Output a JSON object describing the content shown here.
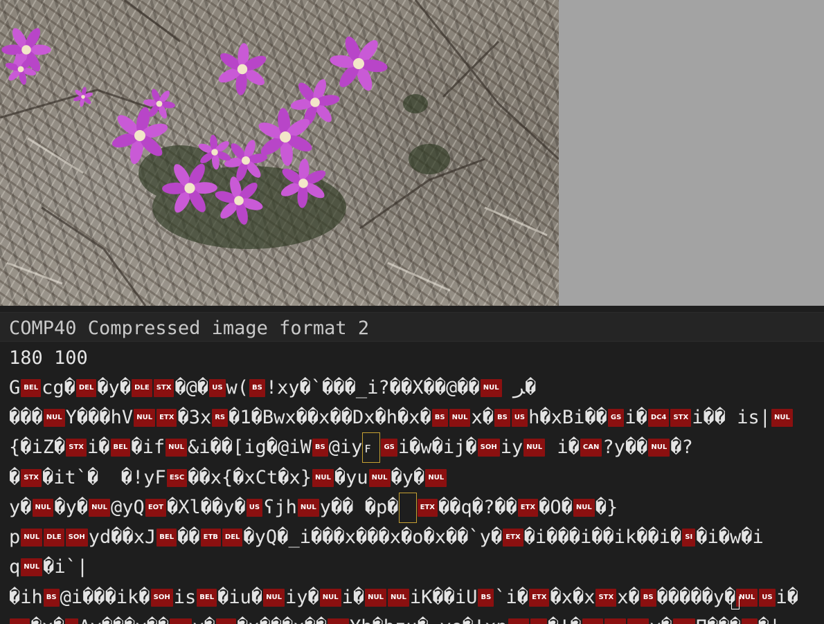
{
  "viewer": {
    "image_alt": "photo of pink star-shaped wildflowers on gravelly ground"
  },
  "editor": {
    "lines": [
      [
        {
          "t": "COMP40 Compressed image format 2"
        }
      ],
      [
        {
          "t": "180 100"
        }
      ],
      [
        {
          "t": "G"
        },
        {
          "c": "BEL"
        },
        {
          "t": "cg�"
        },
        {
          "c": "DEL"
        },
        {
          "t": "�y�"
        },
        {
          "c": "DLE"
        },
        {
          "c": "STX"
        },
        {
          "t": "�@�"
        },
        {
          "c": "US"
        },
        {
          "t": "w("
        },
        {
          "c": "BS"
        },
        {
          "t": "!xy�`���_i?��X��@��"
        },
        {
          "c": "NUL"
        },
        {
          "t": " ﺮ�"
        }
      ],
      [
        {
          "t": "���"
        },
        {
          "c": "NUL"
        },
        {
          "t": "Y���hV"
        },
        {
          "c": "NUL"
        },
        {
          "c": "ETX"
        },
        {
          "t": "�3x"
        },
        {
          "c": "RS"
        },
        {
          "t": "�1�Bwx��x��Dx�h�x�"
        },
        {
          "c": "BS"
        },
        {
          "c": "NUL"
        },
        {
          "t": "x�"
        },
        {
          "c": "BS"
        },
        {
          "c": "US"
        },
        {
          "t": "h�xBi��"
        },
        {
          "c": "GS"
        },
        {
          "t": "i�"
        },
        {
          "c": "DC4"
        },
        {
          "c": "STX"
        },
        {
          "t": "i�� is|"
        },
        {
          "c": "NUL"
        }
      ],
      [
        {
          "t": "{�iZ�"
        },
        {
          "c": "STX"
        },
        {
          "t": "i�"
        },
        {
          "c": "BEL"
        },
        {
          "t": "�if"
        },
        {
          "c": "NUL"
        },
        {
          "t": "&i��[ig�@iW"
        },
        {
          "c": "BS"
        },
        {
          "t": "@iy"
        },
        {
          "m": "FF"
        },
        {
          "c": "GS"
        },
        {
          "t": "i�w�ij�"
        },
        {
          "c": "SOH"
        },
        {
          "t": "iy"
        },
        {
          "c": "NUL"
        },
        {
          "t": " i�"
        },
        {
          "c": "CAN"
        },
        {
          "t": "?y��"
        },
        {
          "c": "NUL"
        },
        {
          "t": "�?"
        }
      ],
      [
        {
          "t": "�"
        },
        {
          "c": "STX"
        },
        {
          "t": "�it`�  �!yF"
        },
        {
          "c": "ESC"
        },
        {
          "t": "��x{�xCt�x}"
        },
        {
          "c": "NUL"
        },
        {
          "t": "�yu"
        },
        {
          "c": "NUL"
        },
        {
          "t": "�y�"
        },
        {
          "c": "NUL"
        }
      ],
      [
        {
          "t": "y�"
        },
        {
          "c": "NUL"
        },
        {
          "t": "�y�"
        },
        {
          "c": "NUL"
        },
        {
          "t": "@yQ"
        },
        {
          "c": "EOT"
        },
        {
          "t": "�Xl��y�"
        },
        {
          "c": "US"
        },
        {
          "t": "ʕjh"
        },
        {
          "c": "NUL"
        },
        {
          "t": "y�� �p�"
        },
        {
          "m": "`"
        },
        {
          "c": "ETX"
        },
        {
          "t": "��q�?��"
        },
        {
          "c": "ETX"
        },
        {
          "t": "�O�"
        },
        {
          "c": "NUL"
        },
        {
          "t": "�}"
        }
      ],
      [
        {
          "t": "p"
        },
        {
          "c": "NUL"
        },
        {
          "c": "DLE"
        },
        {
          "c": "SOH"
        },
        {
          "t": "yd��xJ"
        },
        {
          "c": "BEL"
        },
        {
          "t": "��"
        },
        {
          "c": "ETB"
        },
        {
          "c": "DEL"
        },
        {
          "t": "�yQ�_i���x���x�o�x��`y�"
        },
        {
          "c": "ETX"
        },
        {
          "t": "�i���i��ik��i�"
        },
        {
          "c": "SI"
        },
        {
          "t": "�i�w�i"
        }
      ],
      [
        {
          "t": "q"
        },
        {
          "c": "NUL"
        },
        {
          "t": "�i`|"
        }
      ],
      [
        {
          "t": "�ih"
        },
        {
          "c": "BS"
        },
        {
          "t": "@i���ik�"
        },
        {
          "c": "SOH"
        },
        {
          "t": "is"
        },
        {
          "c": "BEL"
        },
        {
          "t": "�iu�"
        },
        {
          "c": "NUL"
        },
        {
          "t": "iy�"
        },
        {
          "c": "NUL"
        },
        {
          "t": "i�"
        },
        {
          "c": "NUL"
        },
        {
          "c": "NUL"
        },
        {
          "t": "iK��iU"
        },
        {
          "c": "BS"
        },
        {
          "t": "`i�"
        },
        {
          "c": "ETX"
        },
        {
          "t": "�x�x"
        },
        {
          "c": "STX"
        },
        {
          "t": "x�"
        },
        {
          "c": "BS"
        },
        {
          "t": "�����y�"
        },
        {
          "c": "NUL"
        },
        {
          "c": "US"
        },
        {
          "t": "i�"
        }
      ],
      [
        {
          "c": "ETX"
        },
        {
          "t": "�x�"
        },
        {
          "c": "SI"
        },
        {
          "t": "Ay���y��"
        },
        {
          "c": "SOH"
        },
        {
          "t": "y�"
        },
        {
          "c": "ETX"
        },
        {
          "t": "�x���x��"
        },
        {
          "c": "NUL"
        },
        {
          "t": "Yh�bzu�=ye�!xp"
        },
        {
          "c": "NUL"
        },
        {
          "c": "US"
        },
        {
          "t": "�!�"
        },
        {
          "c": "NUL"
        },
        {
          "c": "NUL"
        },
        {
          "c": "NUL"
        },
        {
          "t": "y�"
        },
        {
          "c": "SOH"
        },
        {
          "t": "Π���"
        },
        {
          "c": "BS"
        },
        {
          "t": "�|"
        }
      ]
    ]
  }
}
